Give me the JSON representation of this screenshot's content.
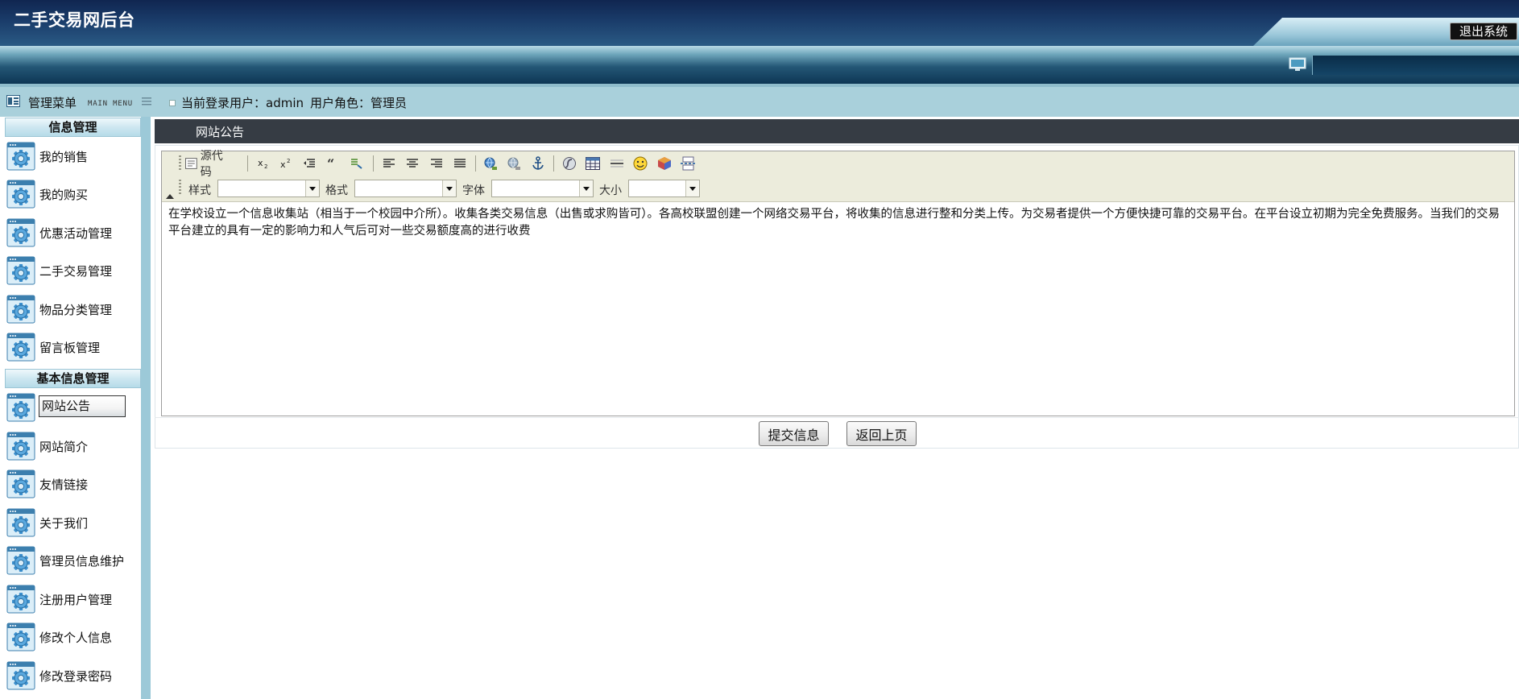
{
  "header": {
    "title": "二手交易网后台",
    "logout_label": "退出系统"
  },
  "menubar": {
    "menu_title": "管理菜单",
    "menu_subtitle": "MAIN MENU",
    "current_user_label": "当前登录用户：admin",
    "role_label": "用户角色：管理员"
  },
  "sidebar": {
    "groups": [
      {
        "title": "信息管理",
        "items": [
          {
            "label": "我的销售"
          },
          {
            "label": "我的购买"
          },
          {
            "label": "优惠活动管理"
          },
          {
            "label": "二手交易管理"
          },
          {
            "label": "物品分类管理"
          },
          {
            "label": "留言板管理"
          }
        ]
      },
      {
        "title": "基本信息管理",
        "items": [
          {
            "label": "网站公告",
            "active": true
          },
          {
            "label": "网站简介"
          },
          {
            "label": "友情链接"
          },
          {
            "label": "关于我们"
          },
          {
            "label": "管理员信息维护"
          },
          {
            "label": "注册用户管理"
          },
          {
            "label": "修改个人信息"
          },
          {
            "label": "修改登录密码"
          }
        ]
      }
    ]
  },
  "content": {
    "section_title": "网站公告",
    "editor": {
      "source_label": "源代码",
      "style_label": "样式",
      "format_label": "格式",
      "font_label": "字体",
      "size_label": "大小",
      "style_value": "",
      "format_value": "",
      "font_value": "",
      "size_value": "",
      "body_text": "在学校设立一个信息收集站（相当于一个校园中介所）。收集各类交易信息（出售或求购皆可）。各高校联盟创建一个网络交易平台，将收集的信息进行整和分类上传。为交易者提供一个方便快捷可靠的交易平台。在平台设立初期为完全免费服务。当我们的交易平台建立的具有一定的影响力和人气后可对一些交易额度高的进行收费"
    },
    "submit_label": "提交信息",
    "back_label": "返回上页"
  }
}
